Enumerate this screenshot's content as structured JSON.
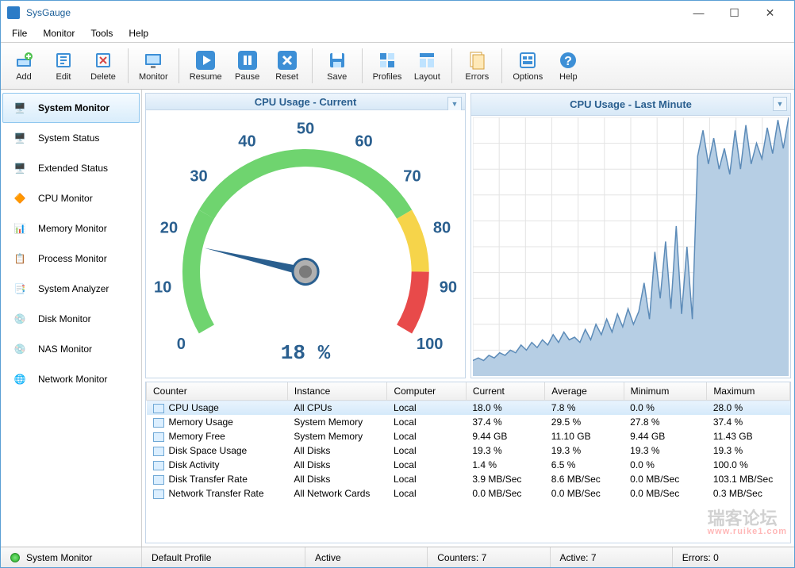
{
  "app": {
    "title": "SysGauge"
  },
  "menu": [
    "File",
    "Monitor",
    "Tools",
    "Help"
  ],
  "toolbar": {
    "add": "Add",
    "edit": "Edit",
    "delete": "Delete",
    "monitor": "Monitor",
    "resume": "Resume",
    "pause": "Pause",
    "reset": "Reset",
    "save": "Save",
    "profiles": "Profiles",
    "layout": "Layout",
    "errors": "Errors",
    "options": "Options",
    "help": "Help"
  },
  "sidebar": {
    "items": [
      {
        "label": "System Monitor"
      },
      {
        "label": "System Status"
      },
      {
        "label": "Extended Status"
      },
      {
        "label": "CPU Monitor"
      },
      {
        "label": "Memory Monitor"
      },
      {
        "label": "Process Monitor"
      },
      {
        "label": "System Analyzer"
      },
      {
        "label": "Disk Monitor"
      },
      {
        "label": "NAS Monitor"
      },
      {
        "label": "Network Monitor"
      }
    ],
    "active_index": 0
  },
  "gauge_left": {
    "title": "CPU Usage - Current",
    "value_text": "18 %",
    "value_num": 18
  },
  "gauge_right": {
    "title": "CPU Usage - Last Minute"
  },
  "table": {
    "headers": [
      "Counter",
      "Instance",
      "Computer",
      "Current",
      "Average",
      "Minimum",
      "Maximum"
    ],
    "rows": [
      {
        "counter": "CPU Usage",
        "instance": "All CPUs",
        "computer": "Local",
        "current": "18.0 %",
        "average": "7.8 %",
        "minimum": "0.0 %",
        "maximum": "28.0 %"
      },
      {
        "counter": "Memory Usage",
        "instance": "System Memory",
        "computer": "Local",
        "current": "37.4 %",
        "average": "29.5 %",
        "minimum": "27.8 %",
        "maximum": "37.4 %"
      },
      {
        "counter": "Memory Free",
        "instance": "System Memory",
        "computer": "Local",
        "current": "9.44 GB",
        "average": "11.10 GB",
        "minimum": "9.44 GB",
        "maximum": "11.43 GB"
      },
      {
        "counter": "Disk Space Usage",
        "instance": "All Disks",
        "computer": "Local",
        "current": "19.3 %",
        "average": "19.3 %",
        "minimum": "19.3 %",
        "maximum": "19.3 %"
      },
      {
        "counter": "Disk Activity",
        "instance": "All Disks",
        "computer": "Local",
        "current": "1.4 %",
        "average": "6.5 %",
        "minimum": "0.0 %",
        "maximum": "100.0 %"
      },
      {
        "counter": "Disk Transfer Rate",
        "instance": "All Disks",
        "computer": "Local",
        "current": "3.9 MB/Sec",
        "average": "8.6 MB/Sec",
        "minimum": "0.0 MB/Sec",
        "maximum": "103.1 MB/Sec"
      },
      {
        "counter": "Network Transfer Rate",
        "instance": "All Network Cards",
        "computer": "Local",
        "current": "0.0 MB/Sec",
        "average": "0.0 MB/Sec",
        "minimum": "0.0 MB/Sec",
        "maximum": "0.3 MB/Sec"
      }
    ],
    "selected_index": 0
  },
  "status": {
    "mode": "System Monitor",
    "profile": "Default Profile",
    "state": "Active",
    "counters": "Counters: 7",
    "active": "Active: 7",
    "errors": "Errors: 0"
  },
  "chart_data": {
    "type": "line",
    "title": "CPU Usage - Last Minute",
    "ylim": [
      0,
      100
    ],
    "xlabel": "",
    "ylabel": "",
    "values": [
      6,
      7,
      6,
      8,
      7,
      9,
      8,
      10,
      9,
      12,
      10,
      13,
      11,
      14,
      12,
      16,
      13,
      17,
      14,
      15,
      13,
      18,
      14,
      20,
      16,
      22,
      17,
      24,
      19,
      26,
      20,
      25,
      36,
      22,
      48,
      30,
      52,
      26,
      58,
      24,
      50,
      22,
      85,
      95,
      82,
      92,
      80,
      88,
      78,
      95,
      80,
      97,
      82,
      90,
      84,
      96,
      86,
      99,
      88,
      100
    ]
  },
  "gauge_ticks": {
    "labels": [
      "0",
      "10",
      "20",
      "30",
      "40",
      "50",
      "60",
      "70",
      "80",
      "90",
      "100"
    ]
  },
  "watermark": {
    "main": "瑞客论坛",
    "sub": "www.ruike1.com"
  }
}
